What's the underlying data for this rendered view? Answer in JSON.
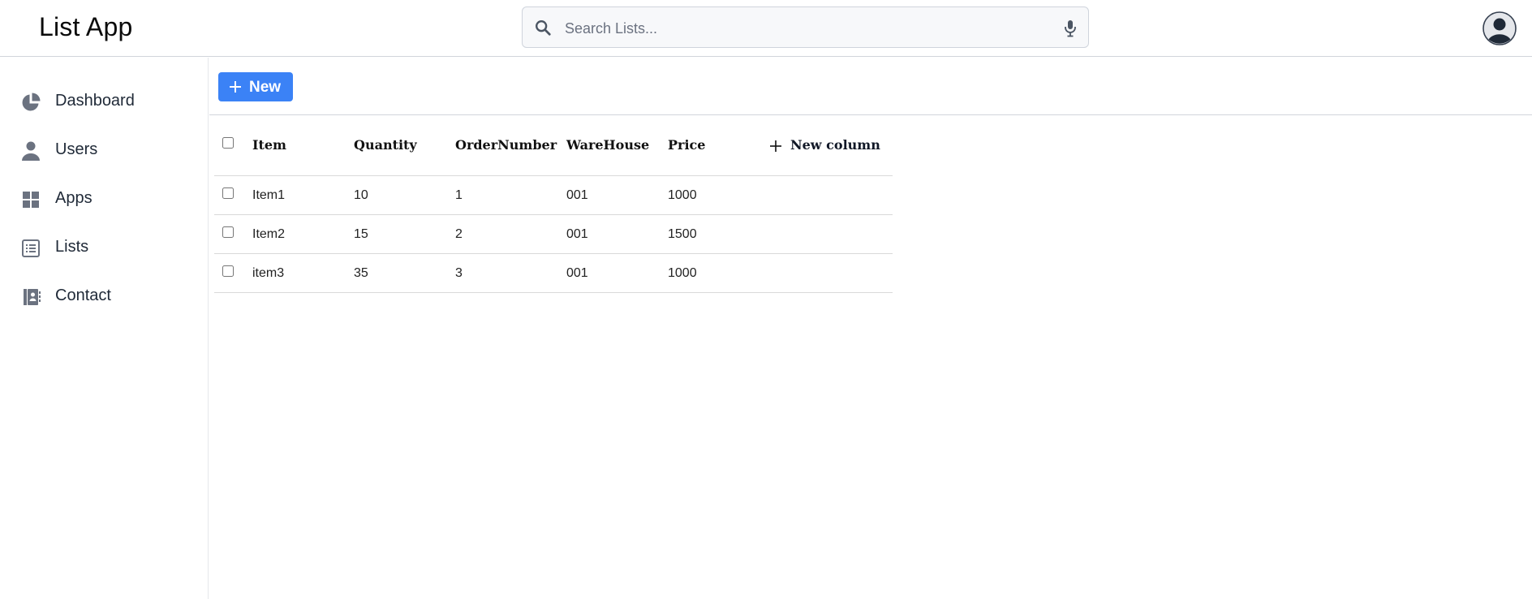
{
  "header": {
    "app_title": "List App",
    "search": {
      "placeholder": "Search Lists...",
      "value": ""
    }
  },
  "sidebar": {
    "items": [
      {
        "label": "Dashboard",
        "icon": "pie-chart-icon"
      },
      {
        "label": "Users",
        "icon": "user-icon"
      },
      {
        "label": "Apps",
        "icon": "apps-grid-icon"
      },
      {
        "label": "Lists",
        "icon": "list-icon"
      },
      {
        "label": "Contact",
        "icon": "contact-book-icon"
      }
    ]
  },
  "toolbar": {
    "new_label": "New"
  },
  "table": {
    "columns": [
      "Item",
      "Quantity",
      "OrderNumber",
      "WareHouse",
      "Price"
    ],
    "new_column_label": "New column",
    "rows": [
      [
        "Item1",
        "10",
        "1",
        "001",
        "1000"
      ],
      [
        "Item2",
        "15",
        "2",
        "001",
        "1500"
      ],
      [
        "item3",
        "35",
        "3",
        "001",
        "1000"
      ]
    ]
  },
  "colors": {
    "primary": "#3b82f6",
    "icon_gray": "#6b7280",
    "border": "#d1d5db"
  }
}
